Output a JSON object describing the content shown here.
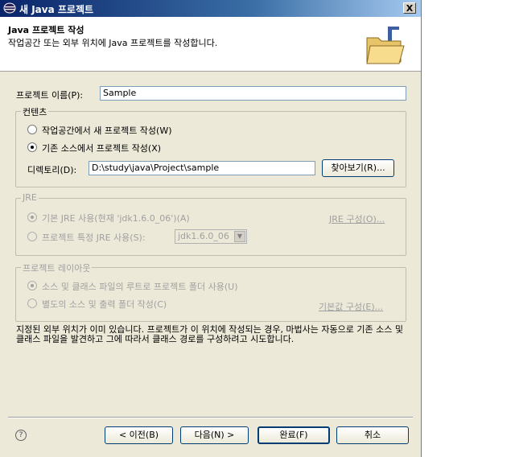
{
  "window": {
    "title": "새 Java 프로젝트",
    "close_label": "X"
  },
  "banner": {
    "title": "Java 프로젝트 작성",
    "description": "작업공간 또는 외부 위치에 Java 프로젝트를 작성합니다."
  },
  "project_name": {
    "label": "프로젝트 이름(P):",
    "value": "Sample"
  },
  "contents": {
    "legend": "컨텐츠",
    "option_workspace": "작업공간에서 새 프로젝트 작성(W)",
    "option_existing": "기존 소스에서 프로젝트 작성(X)",
    "directory_label": "디렉토리(D):",
    "directory_value": "D:\\study\\java\\Project\\sample",
    "browse_label": "찾아보기(R)..."
  },
  "jre": {
    "legend": "JRE",
    "option_default": "기본 JRE 사용(현재 'jdk1.6.0_06')(A)",
    "configure_link": "JRE 구성(O)...",
    "option_specific": "프로젝트 특정 JRE 사용(S):",
    "specific_value": "jdk1.6.0_06"
  },
  "layout": {
    "legend": "프로젝트 레이아웃",
    "option_root": "소스 및 클래스 파일의 루트로 프로젝트 폴더 사용(U)",
    "option_separate": "별도의 소스 및 출력 폴더 작성(C)",
    "defaults_link": "기본값 구성(E)..."
  },
  "message": "지정된 외부 위치가 이미 있습니다. 프로젝트가 이 위치에 작성되는 경우, 마법사는 자동으로 기존 소스 및 클래스 파일을 발견하고 그에 따라서 클래스 경로를 구성하려고 시도합니다.",
  "buttons": {
    "help": "?",
    "back": "< 이전(B)",
    "next": "다음(N) >",
    "finish": "완료(F)",
    "cancel": "취소"
  }
}
